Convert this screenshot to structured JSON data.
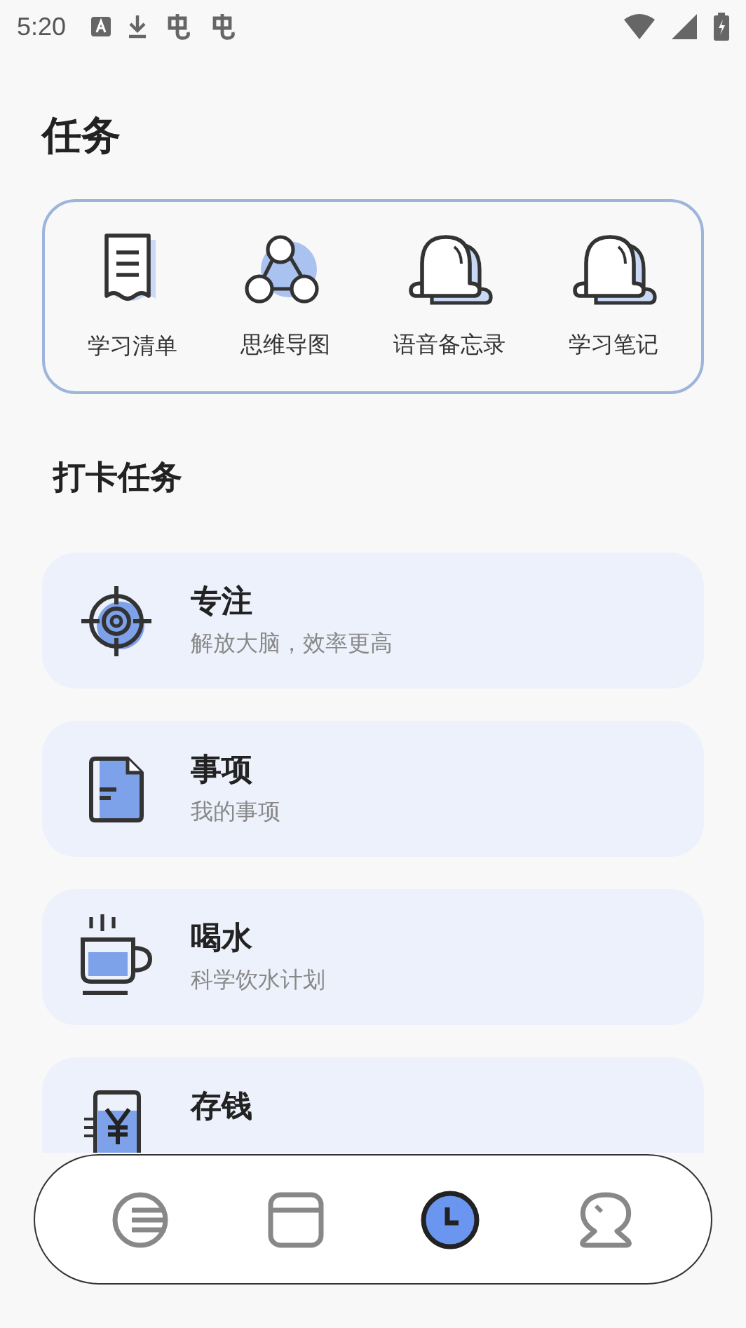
{
  "status_bar": {
    "time": "5:20"
  },
  "title": "任务",
  "tools": [
    {
      "label": "学习清单",
      "kind": "list"
    },
    {
      "label": "思维导图",
      "kind": "mindmap"
    },
    {
      "label": "语音备忘录",
      "kind": "bell"
    },
    {
      "label": "学习笔记",
      "kind": "bell"
    }
  ],
  "section_title": "打卡任务",
  "tasks": [
    {
      "title": "专注",
      "subtitle": "解放大脑，效率更高",
      "kind": "target"
    },
    {
      "title": "事项",
      "subtitle": "我的事项",
      "kind": "doc"
    },
    {
      "title": "喝水",
      "subtitle": "科学饮水计划",
      "kind": "cup"
    },
    {
      "title": "存钱",
      "kind": "money"
    }
  ],
  "nav": [
    {
      "kind": "list",
      "selected": false
    },
    {
      "kind": "calendar",
      "selected": false
    },
    {
      "kind": "clock",
      "selected": true
    },
    {
      "kind": "profile",
      "selected": false
    }
  ]
}
